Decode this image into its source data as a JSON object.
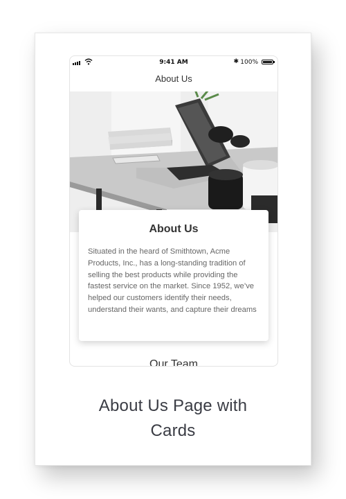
{
  "status_bar": {
    "time": "9:41 AM",
    "bluetooth": "✱",
    "battery_percent": "100%",
    "icons": [
      "signal-icon",
      "wifi-icon",
      "bluetooth-icon",
      "battery-icon"
    ]
  },
  "nav": {
    "title": "About Us"
  },
  "hero": {
    "description_icon": "desk-laptop-photo"
  },
  "about_card": {
    "title": "About Us",
    "body": "Situated in the heard of Smithtown, Acme Products, Inc., has a long-standing tradition of selling the best products while providing the fastest service on the market. Since 1952, we’ve helped our customers identify their needs, understand their wants, and capture their dreams"
  },
  "team": {
    "heading": "Our Team"
  },
  "caption": {
    "line1": "About Us Page with",
    "line2": "Cards"
  },
  "colors": {
    "text_dark": "#333333",
    "text_body": "#666666",
    "caption": "#3a3c44",
    "background": "#ffffff"
  }
}
